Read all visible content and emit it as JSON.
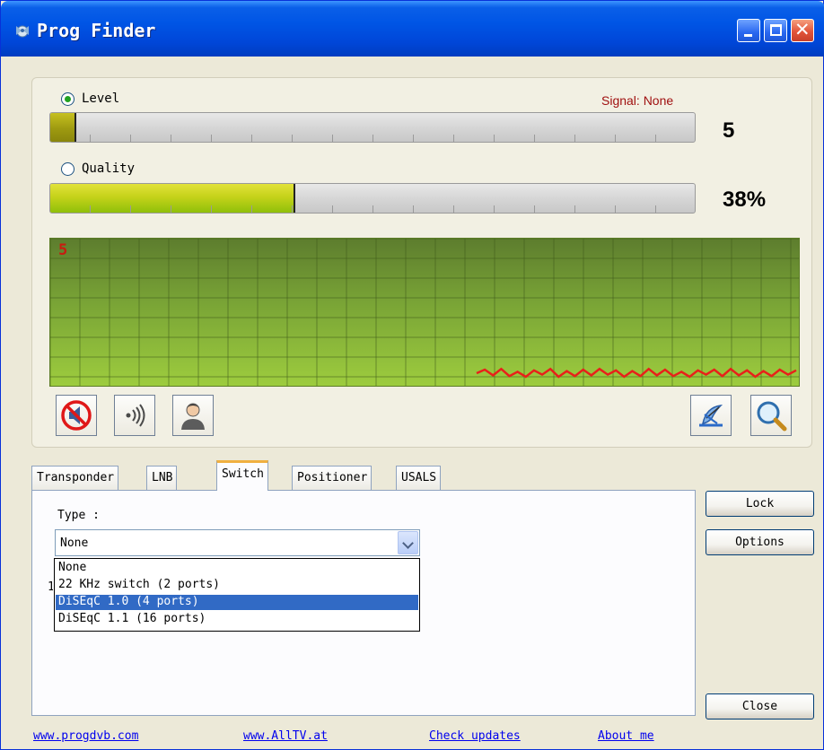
{
  "window": {
    "title": "Prog Finder",
    "icon": "satellite-icon",
    "title_bar_color": "#0055e5"
  },
  "signal": {
    "level_label": "Level",
    "quality_label": "Quality",
    "selected_mode": "Level",
    "status_text": "Signal: None",
    "level_value_text": "5",
    "level_fraction": 0.04,
    "quality_value_text": "38%",
    "quality_fraction": 0.38,
    "graph_label": "5",
    "graph_line_color": "#e8201a"
  },
  "toolbar": {
    "mute_icon": "mute-speaker-icon",
    "sound_icon": "sound-waves-icon",
    "user_icon": "user-profile-icon",
    "dish_icon": "satellite-dish-icon",
    "search_icon": "magnifier-search-icon"
  },
  "tabs": [
    {
      "label": "Transponder"
    },
    {
      "label": "LNB"
    },
    {
      "label": "Switch"
    },
    {
      "label": "Positioner"
    },
    {
      "label": "USALS"
    }
  ],
  "active_tab": "Switch",
  "switch_tab": {
    "type_label": "Type :",
    "selected_value": "None",
    "options": [
      "None",
      "22 KHz switch (2 ports)",
      "DiSEqC 1.0 (4 ports)",
      "DiSEqC 1.1 (16 ports)"
    ],
    "highlighted_option": "DiSEqC 1.0 (4 ports)"
  },
  "buttons": {
    "lock": "Lock",
    "options": "Options",
    "close": "Close"
  },
  "links": [
    "www.progdvb.com",
    "www.AllTV.at",
    "Check updates",
    "About me"
  ]
}
